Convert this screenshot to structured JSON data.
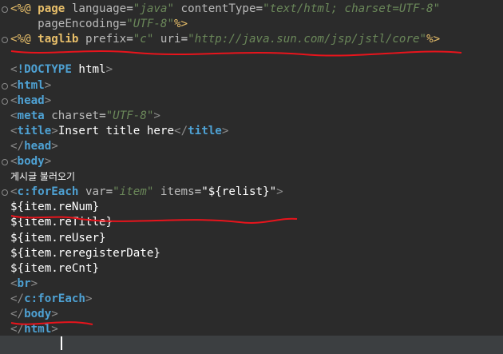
{
  "editor": {
    "lines": [
      {
        "tokens": [
          {
            "c": "br",
            "t": "<%@ "
          },
          {
            "c": "dk",
            "t": "page"
          },
          {
            "c": "at",
            "t": " language"
          },
          {
            "c": "eq",
            "t": "="
          },
          {
            "c": "st",
            "t": "\"java\""
          },
          {
            "c": "at",
            "t": " contentType"
          },
          {
            "c": "eq",
            "t": "="
          },
          {
            "c": "st",
            "t": "\"text/html; charset=UTF-8\""
          }
        ]
      },
      {
        "tokens": [
          {
            "c": "at",
            "t": "    pageEncoding"
          },
          {
            "c": "eq",
            "t": "="
          },
          {
            "c": "st",
            "t": "\"UTF-8\""
          },
          {
            "c": "br",
            "t": "%>"
          }
        ]
      },
      {
        "tokens": [
          {
            "c": "br",
            "t": "<%@ "
          },
          {
            "c": "dk",
            "t": "taglib"
          },
          {
            "c": "at",
            "t": " prefix"
          },
          {
            "c": "eq",
            "t": "="
          },
          {
            "c": "st",
            "t": "\"c\""
          },
          {
            "c": "at",
            "t": " uri"
          },
          {
            "c": "eq",
            "t": "="
          },
          {
            "c": "st",
            "t": "\"http://java.sun.com/jsp/jstl/core\""
          },
          {
            "c": "br",
            "t": "%>"
          }
        ]
      },
      {
        "tokens": []
      },
      {
        "tokens": [
          {
            "c": "ab",
            "t": "<"
          },
          {
            "c": "tg",
            "t": "!DOCTYPE"
          },
          {
            "c": "tx",
            "t": " html"
          },
          {
            "c": "ab",
            "t": ">"
          }
        ]
      },
      {
        "tokens": [
          {
            "c": "ab",
            "t": "<"
          },
          {
            "c": "tg",
            "t": "html"
          },
          {
            "c": "ab",
            "t": ">"
          }
        ]
      },
      {
        "tokens": [
          {
            "c": "ab",
            "t": "<"
          },
          {
            "c": "tg",
            "t": "head"
          },
          {
            "c": "ab",
            "t": ">"
          }
        ]
      },
      {
        "tokens": [
          {
            "c": "ab",
            "t": "<"
          },
          {
            "c": "tg",
            "t": "meta"
          },
          {
            "c": "at",
            "t": " charset"
          },
          {
            "c": "eq",
            "t": "="
          },
          {
            "c": "st",
            "t": "\"UTF-8\""
          },
          {
            "c": "ab",
            "t": ">"
          }
        ]
      },
      {
        "tokens": [
          {
            "c": "ab",
            "t": "<"
          },
          {
            "c": "tg",
            "t": "title"
          },
          {
            "c": "ab",
            "t": ">"
          },
          {
            "c": "tx",
            "t": "Insert title here"
          },
          {
            "c": "ab",
            "t": "</"
          },
          {
            "c": "tg",
            "t": "title"
          },
          {
            "c": "ab",
            "t": ">"
          }
        ]
      },
      {
        "tokens": [
          {
            "c": "ab",
            "t": "</"
          },
          {
            "c": "tg",
            "t": "head"
          },
          {
            "c": "ab",
            "t": ">"
          }
        ]
      },
      {
        "tokens": [
          {
            "c": "ab",
            "t": "<"
          },
          {
            "c": "tg",
            "t": "body"
          },
          {
            "c": "ab",
            "t": ">"
          }
        ]
      },
      {
        "tokens": [
          {
            "c": "ko",
            "t": "게시글 불러오기"
          }
        ]
      },
      {
        "tokens": [
          {
            "c": "ab",
            "t": "<"
          },
          {
            "c": "tg",
            "t": "c:forEach"
          },
          {
            "c": "at",
            "t": " var"
          },
          {
            "c": "eq",
            "t": "="
          },
          {
            "c": "st",
            "t": "\"item\""
          },
          {
            "c": "at",
            "t": " items"
          },
          {
            "c": "eq",
            "t": "="
          },
          {
            "c": "tx",
            "t": "\"${relist}\""
          },
          {
            "c": "ab",
            "t": ">"
          }
        ]
      },
      {
        "tokens": [
          {
            "c": "el",
            "t": "${item.reNum}"
          }
        ]
      },
      {
        "tokens": [
          {
            "c": "el",
            "t": "${item.reTitle}"
          }
        ]
      },
      {
        "tokens": [
          {
            "c": "el",
            "t": "${item.reUser}"
          }
        ]
      },
      {
        "tokens": [
          {
            "c": "el",
            "t": "${item.reregisterDate}"
          }
        ]
      },
      {
        "tokens": [
          {
            "c": "el",
            "t": "${item.reCnt}"
          }
        ]
      },
      {
        "tokens": [
          {
            "c": "ab",
            "t": "<"
          },
          {
            "c": "tg",
            "t": "br"
          },
          {
            "c": "ab",
            "t": ">"
          }
        ]
      },
      {
        "tokens": [
          {
            "c": "ab",
            "t": "</"
          },
          {
            "c": "tg",
            "t": "c:forEach"
          },
          {
            "c": "ab",
            "t": ">"
          }
        ]
      },
      {
        "tokens": [
          {
            "c": "ab",
            "t": "</"
          },
          {
            "c": "tg",
            "t": "body"
          },
          {
            "c": "ab",
            "t": ">"
          }
        ]
      },
      {
        "tokens": [
          {
            "c": "ab",
            "t": "</"
          },
          {
            "c": "tg",
            "t": "html"
          },
          {
            "c": "ab",
            "t": ">"
          }
        ]
      }
    ],
    "fold_marker_lines": [
      0,
      2,
      5,
      6,
      10,
      12
    ],
    "annotation_color": "#e8141c"
  }
}
